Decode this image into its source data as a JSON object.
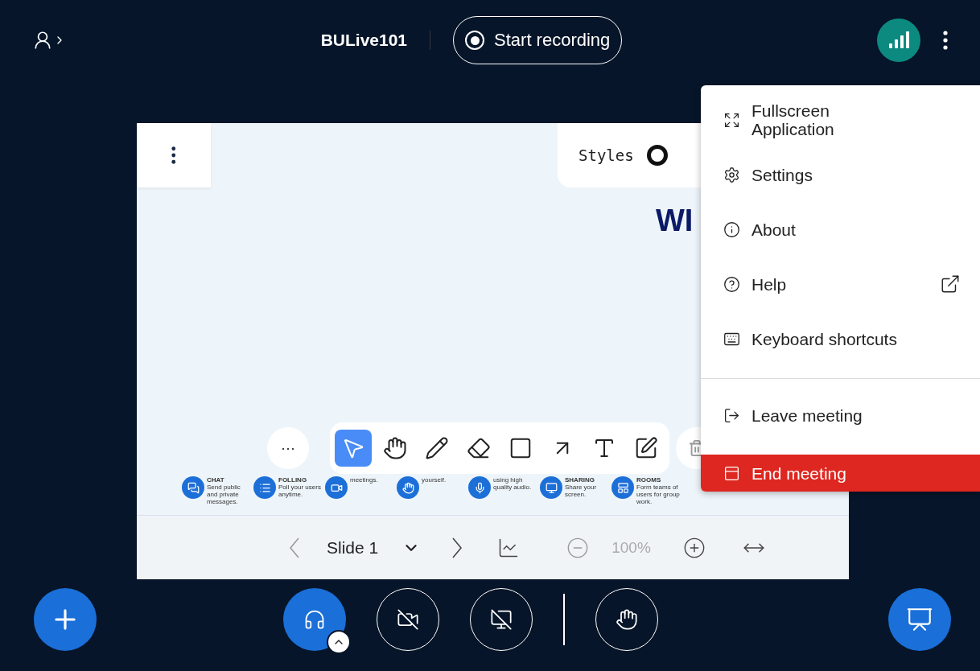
{
  "top_bar": {
    "meeting_name": "BULive101",
    "record_button": "Start recording"
  },
  "whiteboard": {
    "styles_label": "Styles",
    "slide_heading": "WI",
    "features": [
      {
        "title": "CHAT",
        "text": "Send public and private messages."
      },
      {
        "title": "FOLLING",
        "text": "Poll your users anytime."
      },
      {
        "text": "meetings."
      },
      {
        "text": "yourself."
      },
      {
        "text": "using high quality audio."
      },
      {
        "title": "SHARING",
        "text": "Share your screen."
      },
      {
        "title": "ROOMS",
        "text": "Form teams of users for group work."
      }
    ],
    "more_button": "···",
    "tools": [
      {
        "selected": true
      },
      {
        "selected": false
      },
      {
        "selected": false
      },
      {
        "selected": false
      },
      {
        "selected": false
      },
      {
        "selected": false
      },
      {
        "selected": false
      },
      {
        "selected": false
      }
    ],
    "slide_label": "Slide 1",
    "zoom": "100%"
  },
  "menu": {
    "sections": [
      [
        {
          "label": "Fullscreen Application",
          "kind": "normal",
          "external": false
        },
        {
          "label": "Settings",
          "kind": "normal",
          "external": false
        },
        {
          "label": "About",
          "kind": "normal",
          "external": false
        },
        {
          "label": "Help",
          "kind": "normal",
          "external": true
        },
        {
          "label": "Keyboard shortcuts",
          "kind": "normal",
          "external": false
        }
      ],
      [
        {
          "label": "Leave meeting",
          "kind": "normal",
          "external": false
        },
        {
          "label": "End meeting",
          "kind": "danger",
          "external": false
        }
      ]
    ]
  },
  "controls": [
    {
      "active": true
    },
    {
      "active": false
    },
    {
      "active": false
    },
    {
      "active": false
    }
  ]
}
